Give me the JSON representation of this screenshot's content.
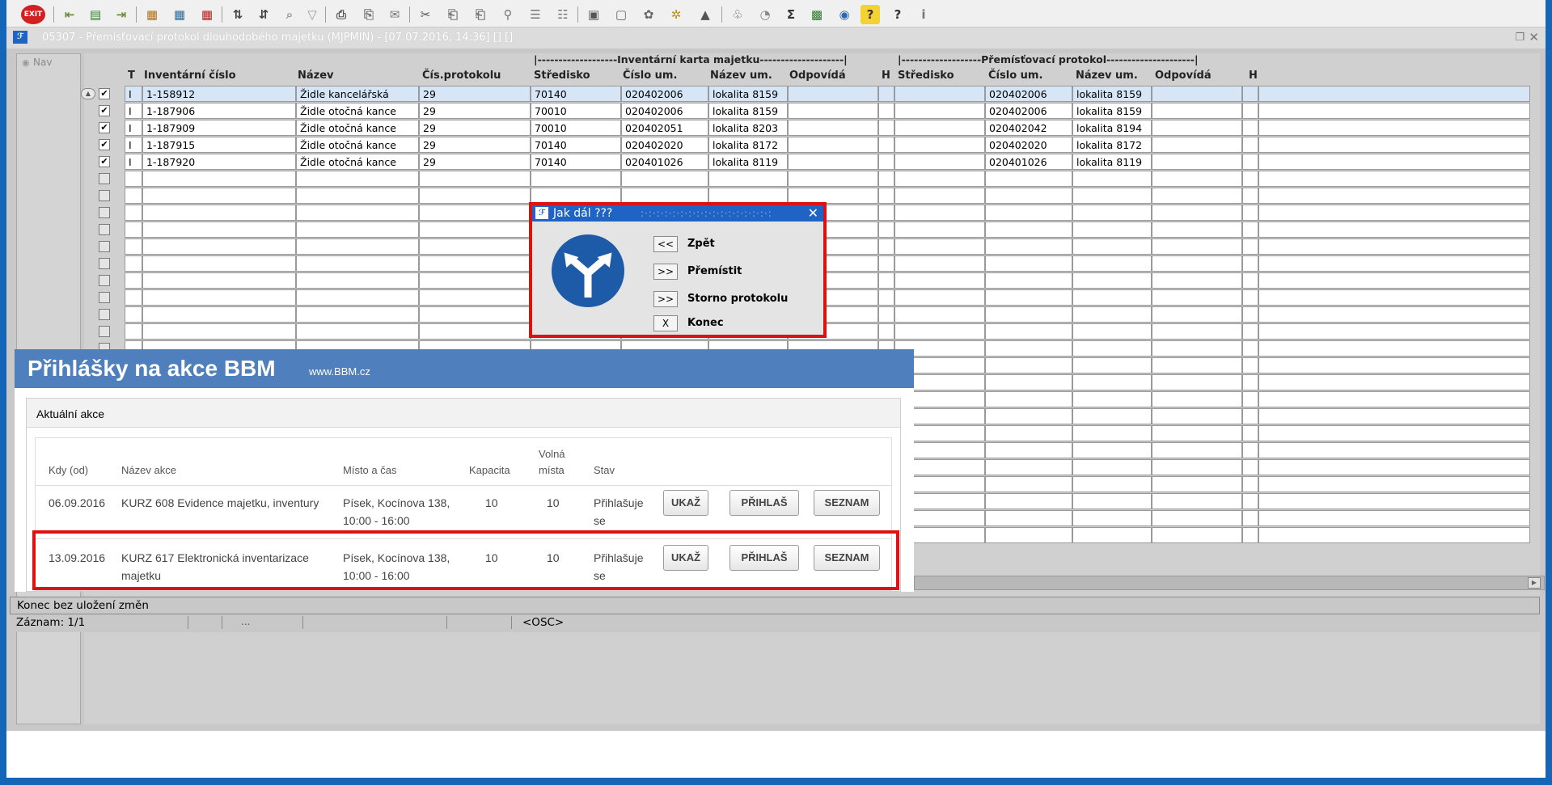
{
  "window": {
    "title": "05307 - Přemísťovací protokol dlouhodobého majetku (MJPMIN) - [07.07.2016, 14:36] [] []",
    "nav_label": "Nav"
  },
  "toolbar": {
    "exit_label": "EXIT",
    "sum_symbol": "Σ",
    "help_symbol": "?",
    "info_symbol": "i"
  },
  "grid": {
    "group_headers": {
      "inventory": "|-------------------Inventární karta majetku--------------------|",
      "transfer": "|-------------------Přemísťovací protokol---------------------|"
    },
    "headers": [
      "T",
      "Inventární číslo",
      "Název",
      "Čís.protokolu",
      "Středisko",
      "Číslo um.",
      "Název um.",
      "Odpovídá",
      "H",
      "Středisko",
      "Číslo um.",
      "Název um.",
      "Odpovídá",
      "H"
    ],
    "rows": [
      {
        "checked": "✔",
        "type": "I",
        "inv": "1-158912",
        "name": "Židle kancelářská",
        "protocol": "29",
        "center": "70140",
        "loc": "020402006",
        "locname": "lokalita 8159",
        "newloc": "020402006",
        "newlocname": "lokalita 8159"
      },
      {
        "checked": "✔",
        "type": "I",
        "inv": "1-187906",
        "name": "Židle otočná kance",
        "protocol": "29",
        "center": "70010",
        "loc": "020402006",
        "locname": "lokalita 8159",
        "newloc": "020402006",
        "newlocname": "lokalita 8159"
      },
      {
        "checked": "✔",
        "type": "I",
        "inv": "1-187909",
        "name": "Židle otočná kance",
        "protocol": "29",
        "center": "70010",
        "loc": "020402051",
        "locname": "lokalita 8203",
        "newloc": "020402042",
        "newlocname": "lokalita 8194"
      },
      {
        "checked": "✔",
        "type": "I",
        "inv": "1-187915",
        "name": "Židle otočná kance",
        "protocol": "29",
        "center": "70140",
        "loc": "020402020",
        "locname": "lokalita 8172",
        "newloc": "020402020",
        "newlocname": "lokalita 8172"
      },
      {
        "checked": "✔",
        "type": "I",
        "inv": "1-187920",
        "name": "Židle otočná kance",
        "protocol": "29",
        "center": "70140",
        "loc": "020401026",
        "locname": "lokalita 8119",
        "newloc": "020401026",
        "newlocname": "lokalita 8119"
      }
    ]
  },
  "dialog": {
    "title": "Jak dál ???",
    "options": [
      {
        "btn": "<<",
        "label": "Zpět"
      },
      {
        "btn": ">>",
        "label": "Přemístit"
      },
      {
        "btn": ">>",
        "label": "Storno protokolu"
      },
      {
        "btn": "X",
        "label": "Konec"
      }
    ]
  },
  "web": {
    "title": "Přihlášky na akce BBM",
    "site": "www.BBM.cz",
    "panel_title": "Aktuální akce",
    "headers": {
      "date": "Kdy (od)",
      "name": "Název akce",
      "place": "Místo a čas",
      "capacity": "Kapacita",
      "free_1": "Volná",
      "free_2": "místa",
      "state": "Stav"
    },
    "events": [
      {
        "date": "06.09.2016",
        "name_1": "KURZ 608 Evidence majetku, inventury",
        "name_2": "",
        "place_1": "Písek, Kocínova 138,",
        "place_2": "10:00 - 16:00",
        "capacity": "10",
        "free": "10",
        "state_1": "Přihlašuje",
        "state_2": "se",
        "btn_show": "UKAŽ",
        "btn_signup": "PŘIHLAŠ",
        "btn_list": "SEZNAM"
      },
      {
        "date": "13.09.2016",
        "name_1": "KURZ 617 Elektronická inventarizace",
        "name_2": "majetku",
        "place_1": "Písek, Kocínova 138,",
        "place_2": "10:00 - 16:00",
        "capacity": "10",
        "free": "10",
        "state_1": "Přihlašuje",
        "state_2": "se",
        "btn_show": "UKAŽ",
        "btn_signup": "PŘIHLAŠ",
        "btn_list": "SEZNAM"
      }
    ]
  },
  "status": {
    "message": "Konec bez uložení změn",
    "record": "Záznam: 1/1",
    "dots": "...",
    "mode": "<OSC>"
  },
  "colors": {
    "frame": "#1566b8",
    "dialog_title": "#1f64c4",
    "highlight": "#e01010",
    "banner": "#4f80bd"
  }
}
